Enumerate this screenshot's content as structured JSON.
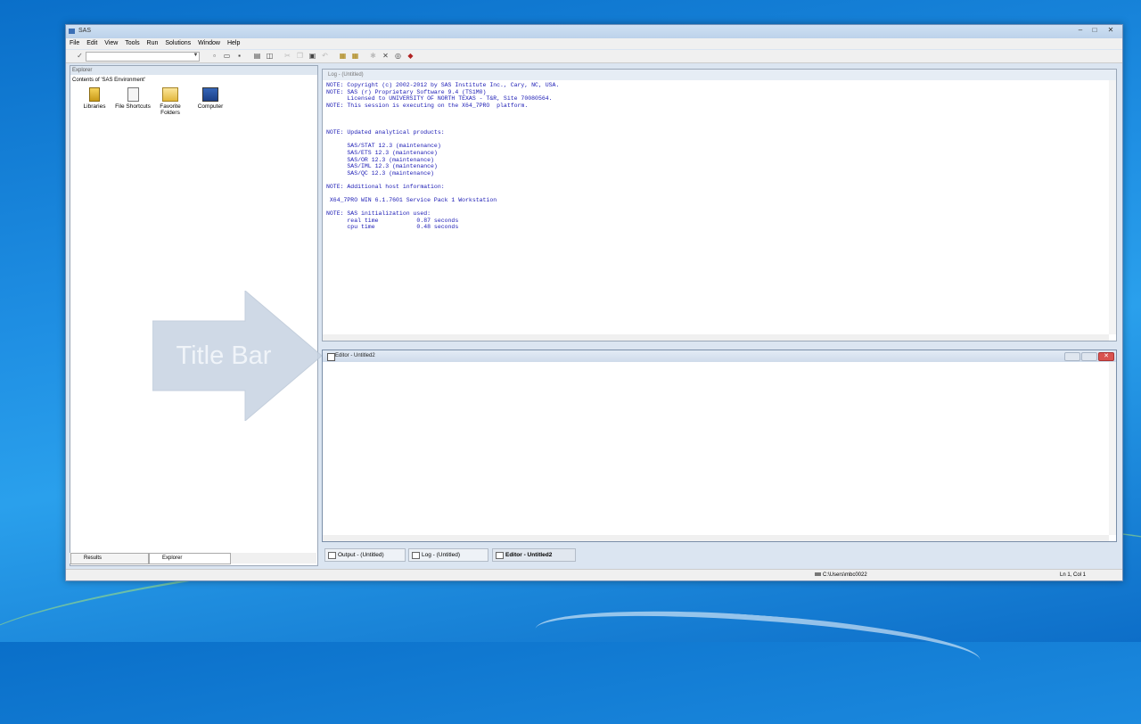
{
  "window": {
    "title": "SAS"
  },
  "menu": [
    "File",
    "Edit",
    "View",
    "Tools",
    "Run",
    "Solutions",
    "Window",
    "Help"
  ],
  "toolbar": {
    "command_value": ""
  },
  "explorer": {
    "title": "Explorer",
    "contents_label": "Contents of 'SAS Environment'",
    "items": [
      {
        "label": "Libraries",
        "icon": "file-cabinet-icon"
      },
      {
        "label": "File Shortcuts",
        "icon": "file-shortcuts-icon"
      },
      {
        "label": "Favorite Folders",
        "icon": "folder-icon"
      },
      {
        "label": "Computer",
        "icon": "computer-icon"
      }
    ],
    "tabs": [
      "Results",
      "Explorer"
    ]
  },
  "log": {
    "title": "Log - (Untitled)",
    "lines": [
      "NOTE: Copyright (c) 2002-2012 by SAS Institute Inc., Cary, NC, USA.",
      "NOTE: SAS (r) Proprietary Software 9.4 (TS1M0)",
      "      Licensed to UNIVERSITY OF NORTH TEXAS - T&R, Site 70080564.",
      "NOTE: This session is executing on the X64_7PRO  platform.",
      "",
      "",
      "",
      "NOTE: Updated analytical products:",
      "",
      "      SAS/STAT 12.3 (maintenance)",
      "      SAS/ETS 12.3 (maintenance)",
      "      SAS/OR 12.3 (maintenance)",
      "      SAS/IML 12.3 (maintenance)",
      "      SAS/QC 12.3 (maintenance)",
      "",
      "NOTE: Additional host information:",
      "",
      " X64_7PRO WIN 6.1.7601 Service Pack 1 Workstation",
      "",
      "NOTE: SAS initialization used:",
      "      real time           0.87 seconds",
      "      cpu time            0.48 seconds"
    ]
  },
  "editor": {
    "title": "Editor - Untitled2"
  },
  "window_tabs": [
    "Output - (Untitled)",
    "Log - (Untitled)",
    "Editor - Untitled2"
  ],
  "status": {
    "path": "C:\\Users\\mbc0022",
    "position": "Ln 1, Col 1"
  },
  "annotation": {
    "text": "Title Bar"
  }
}
